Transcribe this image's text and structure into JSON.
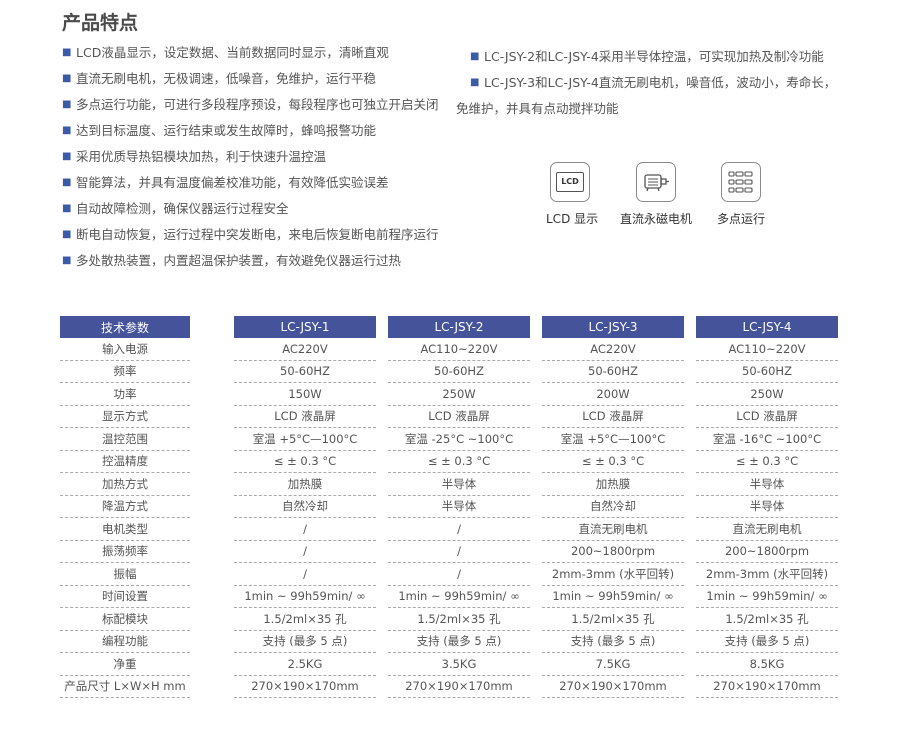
{
  "section_title": "产品特点",
  "features_left": [
    "LCD液晶显示，设定数据、当前数据同时显示，清晰直观",
    "直流无刷电机，无极调速，低噪音，免维护，运行平稳",
    "多点运行功能，可进行多段程序预设，每段程序也可独立开启关闭",
    "达到目标温度、运行结束或发生故障时，蜂鸣报警功能",
    "采用优质导热铝模块加热，利于快速升温控温",
    "智能算法，并具有温度偏差校准功能，有效降低实验误差",
    "自动故障检测，确保仪器运行过程安全",
    "断电自动恢复，运行过程中突发断电，来电后恢复断电前程序运行",
    "多处散热装置，内置超温保护装置，有效避免仪器运行过热"
  ],
  "features_right": [
    {
      "line1": "LC-JSY-2和LC-JSY-4采用半导体控温，可实现加热及制冷功能",
      "line2": ""
    },
    {
      "line1": "LC-JSY-3和LC-JSY-4直流无刷电机，噪音低，波动小，寿命长，",
      "line2": "免维护，并具有点动搅拌功能"
    }
  ],
  "icons": [
    {
      "name": "lcd-display-icon",
      "glyph": "LCD",
      "label": "LCD 显示"
    },
    {
      "name": "dc-motor-icon",
      "label": "直流永磁电机"
    },
    {
      "name": "multi-point-icon",
      "label": "多点运行"
    }
  ],
  "table": {
    "header": [
      "技术参数",
      "LC-JSY-1",
      "LC-JSY-2",
      "LC-JSY-3",
      "LC-JSY-4"
    ],
    "rows": [
      [
        "输入电源",
        "AC220V",
        "AC110~220V",
        "AC220V",
        "AC110~220V"
      ],
      [
        "频率",
        "50-60HZ",
        "50-60HZ",
        "50-60HZ",
        "50-60HZ"
      ],
      [
        "功率",
        "150W",
        "250W",
        "200W",
        "250W"
      ],
      [
        "显示方式",
        "LCD 液晶屏",
        "LCD 液晶屏",
        "LCD 液晶屏",
        "LCD 液晶屏"
      ],
      [
        "温控范围",
        "室温 +5°C—100°C",
        "室温 -25°C ~100°C",
        "室温 +5°C—100°C",
        "室温 -16°C ~100°C"
      ],
      [
        "控温精度",
        "≤ ± 0.3 °C",
        "≤ ± 0.3 °C",
        "≤ ± 0.3 °C",
        "≤ ± 0.3 °C"
      ],
      [
        "加热方式",
        "加热膜",
        "半导体",
        "加热膜",
        "半导体"
      ],
      [
        "降温方式",
        "自然冷却",
        "半导体",
        "自然冷却",
        "半导体"
      ],
      [
        "电机类型",
        "/",
        "/",
        "直流无刷电机",
        "直流无刷电机"
      ],
      [
        "振荡频率",
        "/",
        "/",
        "200~1800rpm",
        "200~1800rpm"
      ],
      [
        "振幅",
        "/",
        "/",
        "2mm-3mm (水平回转)",
        "2mm-3mm (水平回转)"
      ],
      [
        "时间设置",
        "1min ~ 99h59min/ ∞",
        "1min ~ 99h59min/ ∞",
        "1min ~ 99h59min/ ∞",
        "1min ~ 99h59min/ ∞"
      ],
      [
        "标配模块",
        "1.5/2ml×35 孔",
        "1.5/2ml×35 孔",
        "1.5/2ml×35 孔",
        "1.5/2ml×35 孔"
      ],
      [
        "编程功能",
        "支持 (最多 5 点)",
        "支持 (最多 5 点)",
        "支持 (最多 5 点)",
        "支持 (最多 5 点)"
      ],
      [
        "净重",
        "2.5KG",
        "3.5KG",
        "7.5KG",
        "8.5KG"
      ],
      [
        "产品尺寸 L×W×H mm",
        "270×190×170mm",
        "270×190×170mm",
        "270×190×170mm",
        "270×190×170mm"
      ]
    ]
  },
  "colors": {
    "header_bg": "#44539a",
    "bullet": "#3b5aa8"
  }
}
